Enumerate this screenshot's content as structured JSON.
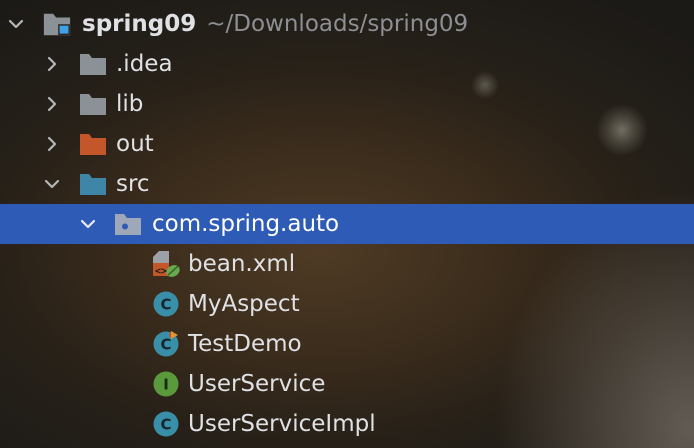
{
  "tree": {
    "root": {
      "name": "spring09",
      "path": "~/Downloads/spring09",
      "icon": "module-folder-icon",
      "expanded": true
    },
    "items": [
      {
        "label": ".idea",
        "icon": "folder-icon",
        "color": "#8c9197",
        "expanded": false
      },
      {
        "label": "lib",
        "icon": "folder-icon",
        "color": "#8c9197",
        "expanded": false
      },
      {
        "label": "out",
        "icon": "excluded-folder-icon",
        "color": "#c4572a",
        "expanded": false
      },
      {
        "label": "src",
        "icon": "source-folder-icon",
        "color": "#3e85a8",
        "expanded": true
      },
      {
        "label": "com.spring.auto",
        "icon": "package-icon",
        "selected": true,
        "expanded": true
      },
      {
        "label": "bean.xml",
        "icon": "spring-xml-icon"
      },
      {
        "label": "MyAspect",
        "icon": "class-icon",
        "badge": "C"
      },
      {
        "label": "TestDemo",
        "icon": "class-main-icon",
        "badge": "C"
      },
      {
        "label": "UserService",
        "icon": "interface-icon",
        "badge": "I"
      },
      {
        "label": "UserServiceImpl",
        "icon": "class-icon",
        "badge": "C"
      }
    ]
  },
  "colors": {
    "selection": "#2d5bb5",
    "class_badge": "#3a8fa8",
    "interface_badge": "#5a9a3c",
    "folder_gray": "#8c9197",
    "folder_excluded": "#c4572a",
    "folder_source": "#3e85a8"
  }
}
